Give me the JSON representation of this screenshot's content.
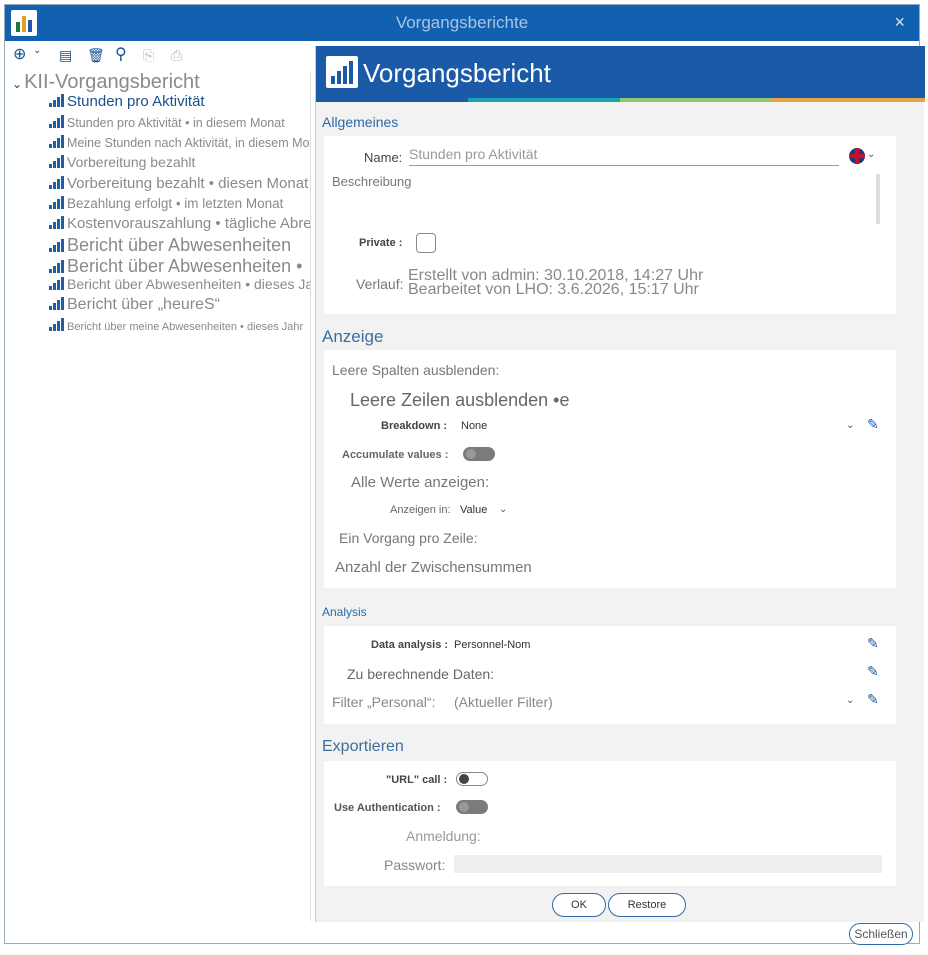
{
  "window": {
    "title": "Vorgangsberichte",
    "close_icon": "×"
  },
  "toolbar": {
    "add": "⊕",
    "add_chevron": "⌄",
    "edit": "▤",
    "delete": "🗑",
    "search": "⚲",
    "copy": "⎘",
    "export": "⎙"
  },
  "tree": {
    "root_label": "KII-Vorgangsbericht",
    "items": [
      {
        "label": "Stunden pro Aktivität",
        "size": 15,
        "selected": true
      },
      {
        "label": "Stunden pro Aktivität • in diesem Monat",
        "size": 12.5
      },
      {
        "label": "Meine Stunden nach Aktivität, in diesem Monat",
        "size": 12.5
      },
      {
        "label": "Vorbereitung bezahlt",
        "size": 14
      },
      {
        "label": "Vorbereitung bezahlt • diesen Monat",
        "size": 15
      },
      {
        "label": "Bezahlung erfolgt • im letzten Monat",
        "size": 13.5
      },
      {
        "label": "Kostenvorauszahlung • tägliche Abrechnung",
        "size": 15
      },
      {
        "label": "Bericht über Abwesenheiten",
        "size": 18
      },
      {
        "label": "Bericht über Abwesenheiten •",
        "size": 18
      },
      {
        "label": "Bericht über Abwesenheiten • dieses Jahr",
        "size": 14
      },
      {
        "label": "Bericht über „heureS“",
        "size": 16
      },
      {
        "label": "Bericht über meine Abwesenheiten • dieses Jahr",
        "size": 11
      }
    ]
  },
  "panel": {
    "title": "Vorgangsbericht",
    "general": {
      "section": "Allgemeines",
      "name_label": "Name:",
      "name_value": "Stunden pro Aktivität",
      "flag_chevron": "⌄",
      "description_label": "Beschreibung",
      "private_label": "Private :",
      "history_label": "Verlauf:",
      "created": "Erstellt von admin: 30.10.2018, 14:27 Uhr",
      "edited": "Bearbeitet von LHO: 3.6.2026, 15:17 Uhr"
    },
    "display": {
      "section": "Anzeige",
      "hide_empty_columns": "Leere Spalten ausblenden:",
      "hide_empty_rows": "Leere Zeilen ausblenden •e",
      "breakdown_label": "Breakdown :",
      "breakdown_value": "None",
      "accumulate_label": "Accumulate values :",
      "show_all_values": "Alle Werte anzeigen:",
      "show_in_label": "Anzeigen in:",
      "show_in_value": "Value",
      "one_per_row": "Ein Vorgang pro Zeile:",
      "subtotals": "Anzahl der Zwischensummen"
    },
    "analysis": {
      "section": "Analysis",
      "data_analysis_label": "Data analysis :",
      "data_analysis_value": "Personnel-Nom",
      "compute_label": "Zu berechnende Daten:",
      "filter_label": "Filter „Personal“:",
      "filter_value": "(Aktueller Filter)"
    },
    "export": {
      "section": "Exportieren",
      "url_call_label": "\"URL\" call :",
      "auth_label": "Use Authentication :",
      "login_label": "Anmeldung:",
      "password_label": "Passwort:"
    },
    "buttons": {
      "ok": "OK",
      "restore": "Restore"
    }
  },
  "footer": {
    "close": "Schließen"
  },
  "colors": {
    "titlebar": "#1260b0",
    "header": "#1a5aa6",
    "stripe": [
      "#1a5aa6",
      "#19a2b5",
      "#8ec86a",
      "#e6a44a"
    ]
  }
}
